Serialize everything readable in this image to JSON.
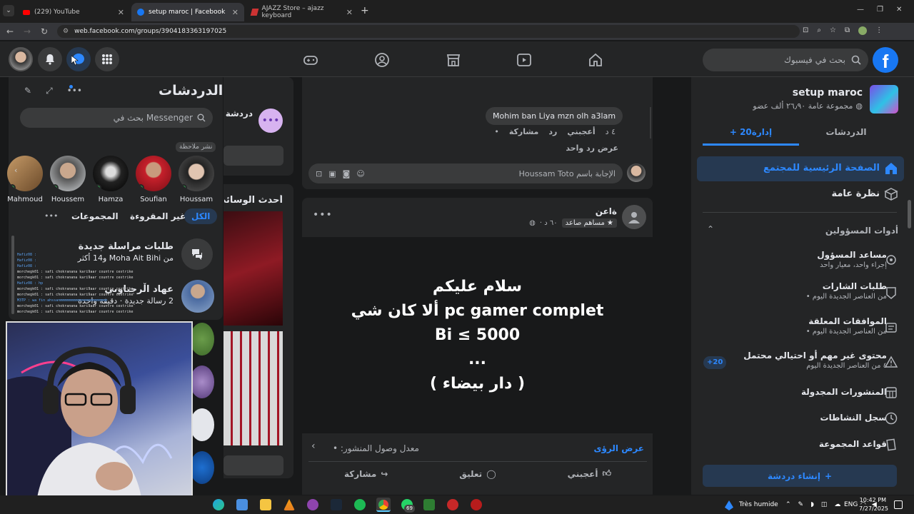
{
  "browser": {
    "tabs": [
      {
        "title": "(229) YouTube",
        "icon": "youtube-icon",
        "active": false
      },
      {
        "title": "setup maroc | Facebook",
        "icon": "facebook-icon",
        "active": true
      },
      {
        "title": "AJAZZ Store – ajazz keyboard",
        "icon": "ajazz-icon",
        "active": false
      }
    ],
    "url": "web.facebook.com/groups/3904183363197025"
  },
  "fb_nav": {
    "search_placeholder": "بحث في فيسبوك"
  },
  "group": {
    "name": "setup maroc",
    "meta": "مجموعة عامة ٢٦٫٩٠ ألف عضو",
    "tab_chats": "الدردشات",
    "tab_manage": "إدارة20 +",
    "nav": [
      {
        "label": "الصفحة الرئيسية للمجتمع",
        "icon": "home-icon",
        "active": true
      },
      {
        "label": "نظرة عامة",
        "icon": "cube-icon",
        "active": false
      }
    ],
    "admin_tools_label": "أدوات المسؤولين",
    "admin_items": [
      {
        "title": "مساعد المسؤول",
        "sub": "إجراء واحد، معيار واحد",
        "icon": "assistant-icon",
        "badge": ""
      },
      {
        "title": "طلبات الشارات",
        "sub": "• من العناصر الجديدة اليوم",
        "icon": "badge-icon",
        "badge": ""
      },
      {
        "title": "الموافقات المعلقة",
        "sub": "• من العناصر الجديدة اليوم",
        "icon": "approvals-icon",
        "badge": ""
      },
      {
        "title": "محتوى غير مهم أو احتيالي محتمل",
        "sub": "٤ من العناصر الجديدة اليوم",
        "icon": "warning-icon",
        "badge": "+20"
      },
      {
        "title": "المنشورات المجدولة",
        "sub": "",
        "icon": "calendar-icon",
        "badge": ""
      },
      {
        "title": "سجل النشاطات",
        "sub": "",
        "icon": "clock-icon",
        "badge": ""
      },
      {
        "title": "قواعد المجموعة",
        "sub": "",
        "icon": "rules-icon",
        "badge": ""
      }
    ],
    "create_chat": "إنشاء دردشة"
  },
  "feed": {
    "comment_reply": "Mohim ban Liya mzn olh a3lam",
    "comment_meta": {
      "time": "٤ د",
      "like": "أعجبني",
      "reply": "رد",
      "share": "مشاركة"
    },
    "one_reply": "عرض رد واحد",
    "reply_as": "الإجابة باسم Houssam Toto",
    "post_author": "ةاعن",
    "post_badge": "مساهم صاعد",
    "post_time": "٦٠ د ·",
    "post_lines": [
      "سلام عليكم",
      "ألا كان شي pc gamer complet",
      "Bi ≤ 5000",
      "...",
      "( دار بيضاء )"
    ],
    "insights": "عرض الرؤى",
    "reach": "معدل وصول المنشور: •",
    "actions": {
      "like": "أعجبني",
      "comment": "تعليق",
      "share": "مشاركة"
    },
    "middle_chat": "دردشة",
    "middle_media": "أحدث الوسائط"
  },
  "messenger": {
    "title": "الدردشات",
    "search_placeholder": "بحث في Messenger",
    "note_hint": "نشر ملاحظة",
    "stories": [
      "Mahmoud",
      "Houssem",
      "Hamza",
      "Soufian",
      "Houssam"
    ],
    "filters": {
      "all": "الكل",
      "unread": "غير المقروءة",
      "groups": "المجموعات"
    },
    "items": [
      {
        "title": "طلبات مراسلة جديدة",
        "sub": "من Moha Ait Bihi و14 أكثر"
      },
      {
        "title": "عهاد اڵرجىاوىي",
        "sub": "2 رسالة جديدة · دقيقة واحدة"
      }
    ]
  },
  "stream_chat": [
    "Hafiz08 : ",
    "Hafiz08 : ",
    "Hafiz08 : ",
    "morchegk01 : safi chokranana kari9aar countre cestrike",
    "morchegk01 : safi chokranana kari9aar countre cestrike",
    "Hafiz08 : hp",
    "morchegk01 : safi chokranana kari9aar countre cestrike",
    "morchegk01 : safi chokranana kari9aar countre cestrike",
    "M3TP : wa fin ahssanmmmmmmmmmmmmmmmmmmmmmm",
    "morchegk01 : safi chokranana kari9aar countre cestrike",
    "morchegk01 : safi chokranana kari9aar countre cestrike"
  ],
  "taskbar": {
    "weather": "Très humide",
    "lang": "ENG",
    "time": "10:42 PM",
    "date": "7/27/2025",
    "badge": "69"
  }
}
